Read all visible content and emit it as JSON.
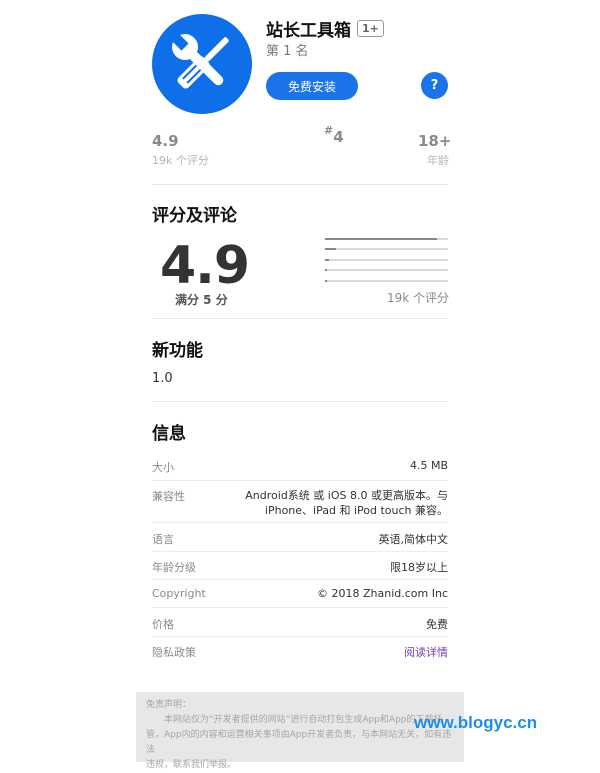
{
  "app": {
    "name": "站长工具箱",
    "age_badge": "1+",
    "rank_text": "第 1 名",
    "install_label": "免费安装",
    "help_label": "?"
  },
  "stats": {
    "rating": "4.9",
    "rating_sub": "19k 个评分",
    "rank_hash": "#",
    "rank_num": "4",
    "age": "18+",
    "age_sub": "年龄"
  },
  "ratings": {
    "heading": "评分及评论",
    "score": "4.9",
    "caption": "满分 5 分",
    "count": "19k 个评分",
    "distribution": [
      0.91,
      0.09,
      0.03,
      0.02,
      0.02
    ]
  },
  "whats_new": {
    "heading": "新功能",
    "version": "1.0"
  },
  "info": {
    "heading": "信息",
    "rows": [
      {
        "key": "大小",
        "value": "4.5 MB"
      },
      {
        "key": "兼容性",
        "value_line1": "Android系统 或 iOS 8.0 或更高版本。与",
        "value_line2": "iPhone、iPad 和 iPod touch 兼容。"
      },
      {
        "key": "语言",
        "value": "英语,简体中文"
      },
      {
        "key": "年龄分级",
        "value": "限18岁以上"
      },
      {
        "key": "Copyright",
        "value": "© 2018 Zhanid.com Inc"
      },
      {
        "key": "价格",
        "value": "免费"
      },
      {
        "key": "隐私政策",
        "value": "阅读详情"
      }
    ]
  },
  "disclaimer": {
    "title": "免责声明：",
    "line1": "本网站仅为“开发者提供的网站”进行自动打包生成App和App的下载托",
    "line2": "管，App内的内容和运营相关事项由App开发者负责，与本网站无关，如有违法",
    "line3": "违规，联系我们举报。"
  },
  "watermark": "www.blogyc.cn",
  "colors": {
    "icon_bg": "#0f6fe8",
    "accent": "#1a73e8",
    "link": "#7a3db8",
    "watermark": "#1f8ee6"
  }
}
